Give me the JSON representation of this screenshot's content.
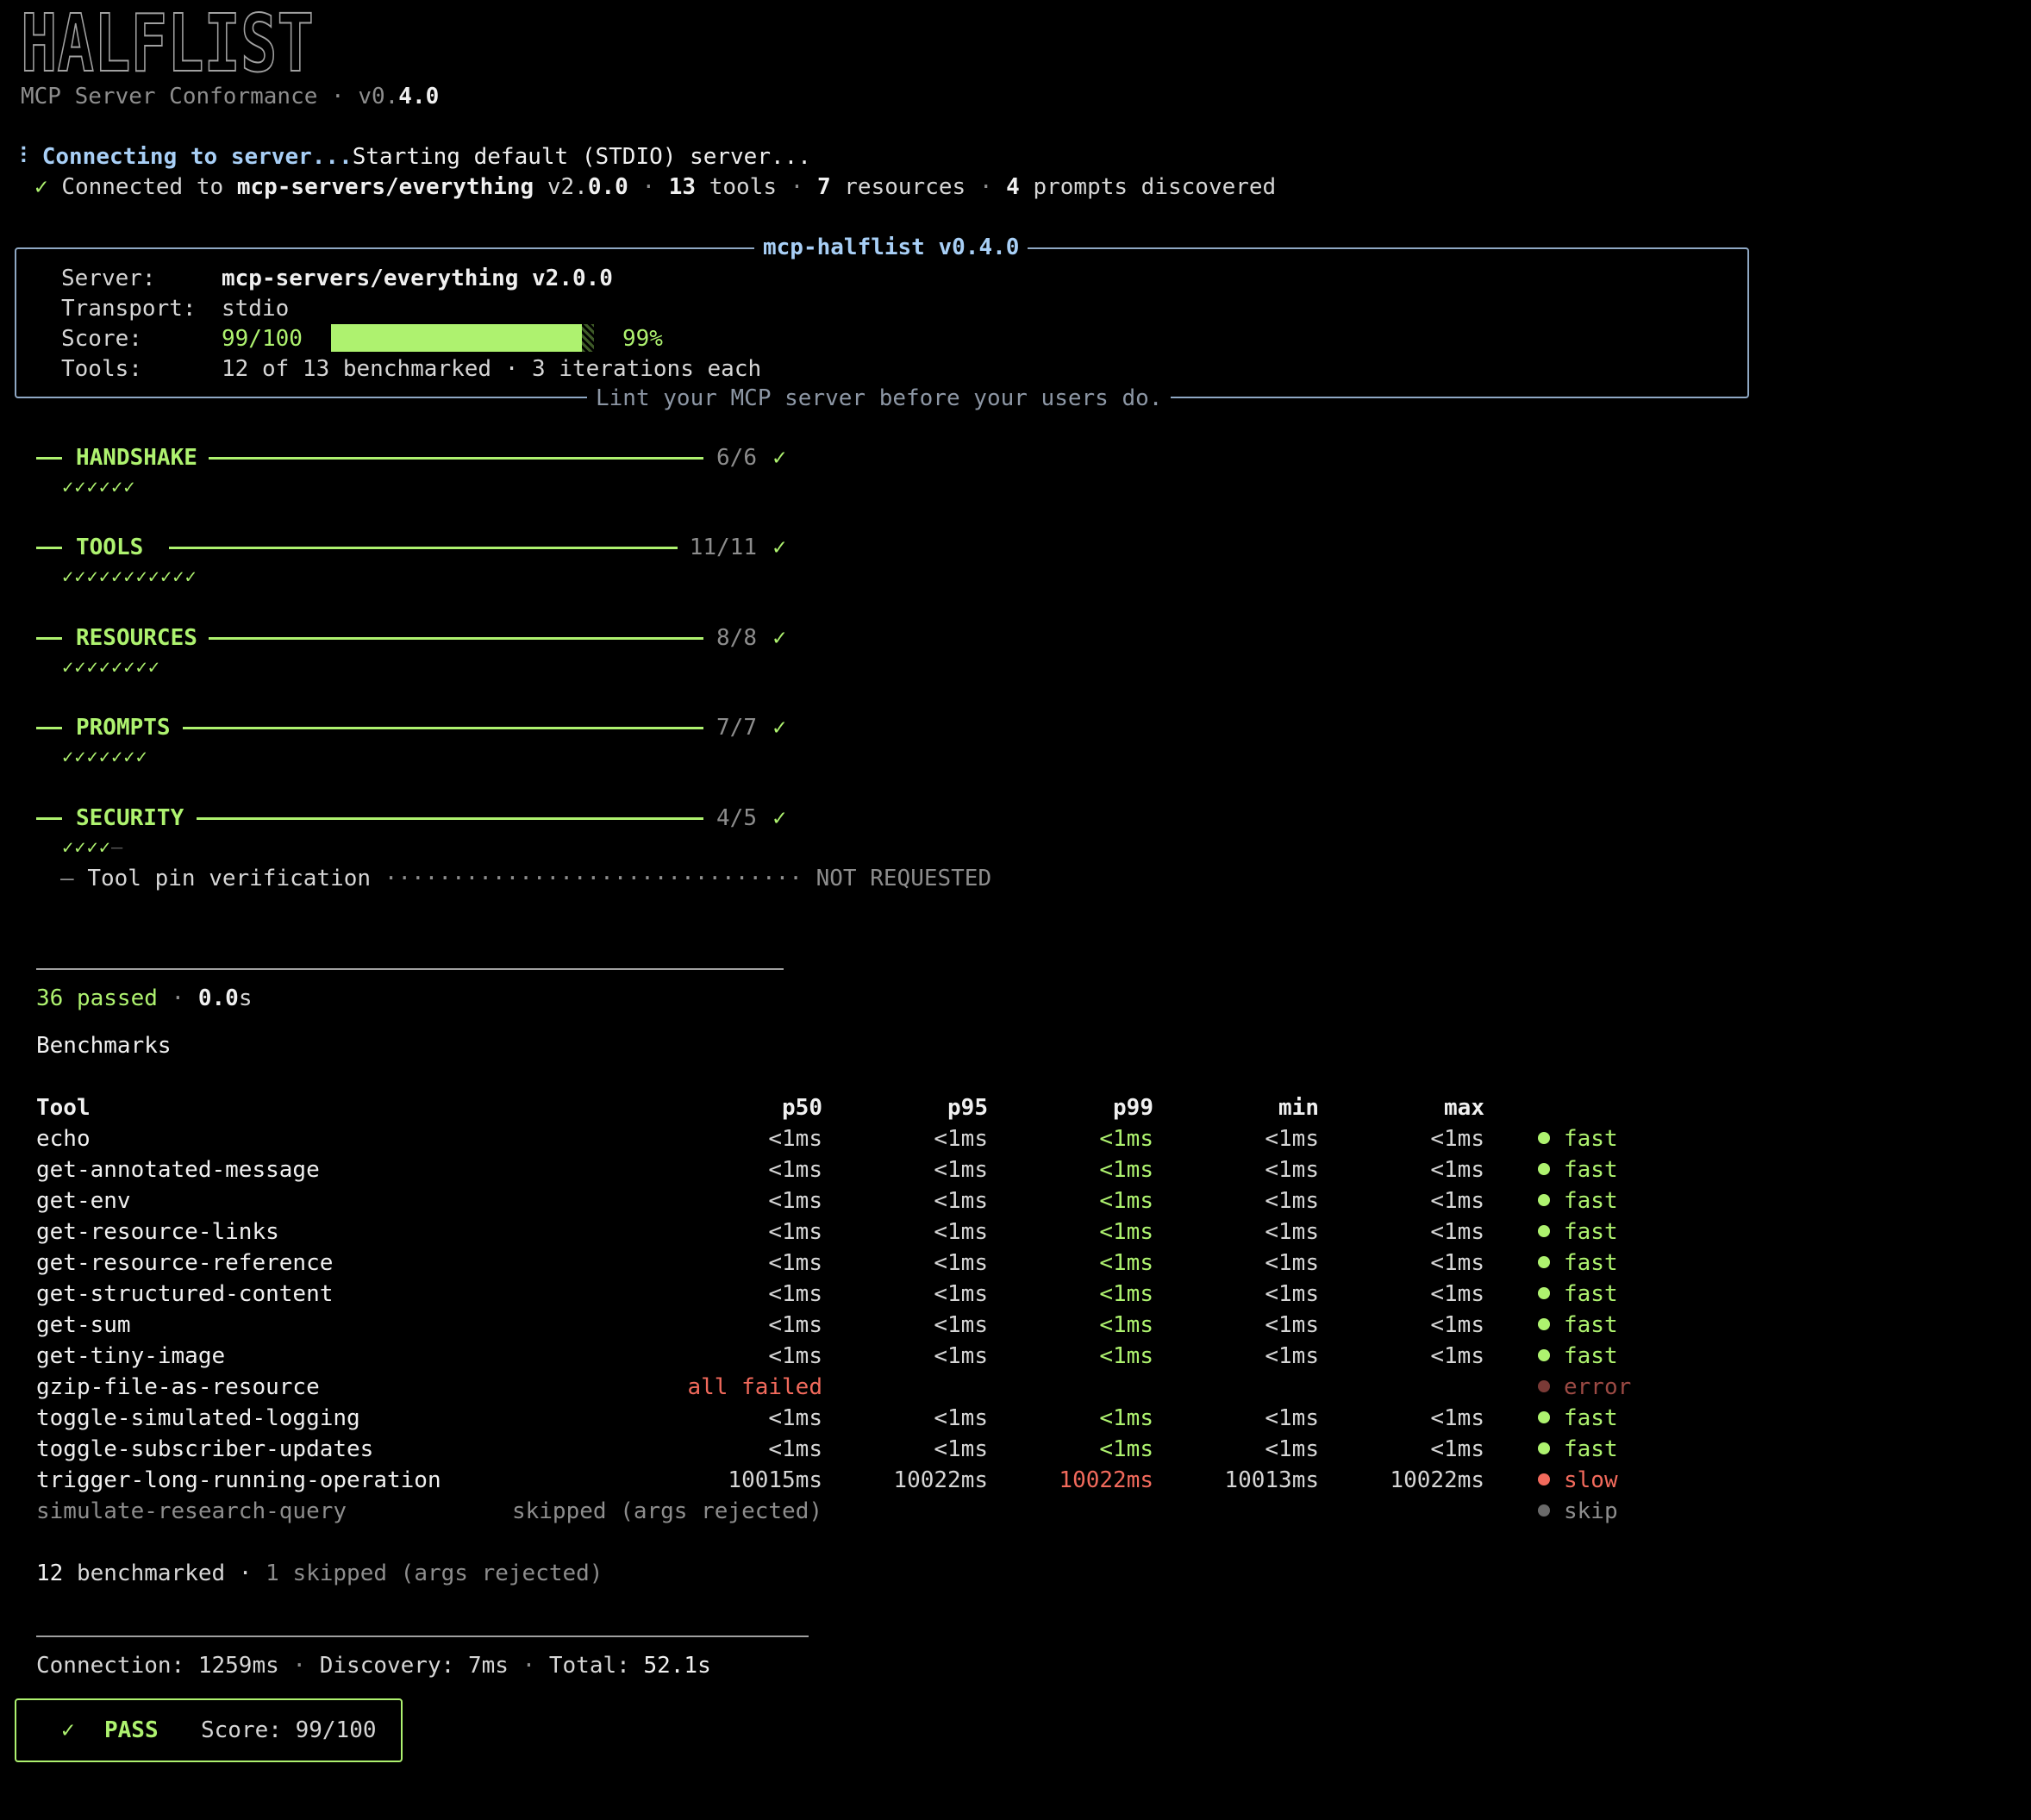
{
  "header": {
    "logo": "HALFLIST",
    "subtitle_prefix": "MCP Server Conformance · v0.",
    "subtitle_version_bold": "4.0"
  },
  "connection": {
    "spinner": "⠸",
    "connecting_label": "Connecting to server...",
    "starting_label": "Starting default (STDIO) server...",
    "connected_check": "✓",
    "connected_prefix": "Connected to",
    "server_name": "mcp-servers/everything",
    "server_version_prefix": "v2.",
    "server_version_bold": "0.0",
    "tools_count": "13",
    "tools_label": "tools",
    "resources_count": "7",
    "resources_label": "resources",
    "prompts_count": "4",
    "prompts_label": "prompts discovered"
  },
  "summary": {
    "title": "mcp-halflist v0.4.0",
    "footer": "Lint your MCP server before your users do.",
    "server_label": "Server:",
    "server_value": "mcp-servers/everything v2.0.0",
    "transport_label": "Transport:",
    "transport_value": "stdio",
    "score_label": "Score:",
    "score_value": "99/100",
    "score_percent": "99%",
    "score_fraction": 0.99,
    "tools_label": "Tools:",
    "tools_value": "12 of 13 benchmarked · 3 iterations each"
  },
  "sections": [
    {
      "title": "HANDSHAKE",
      "count": "6/6",
      "tick": "✓",
      "checks": "✓✓✓✓✓✓",
      "pending": ""
    },
    {
      "title": "TOOLS",
      "count": "11/11",
      "tick": "✓",
      "checks": "✓✓✓✓✓✓✓✓✓✓✓",
      "pending": ""
    },
    {
      "title": "RESOURCES",
      "count": "8/8",
      "tick": "✓",
      "checks": "✓✓✓✓✓✓✓✓",
      "pending": ""
    },
    {
      "title": "PROMPTS",
      "count": "7/7",
      "tick": "✓",
      "checks": "✓✓✓✓✓✓✓",
      "pending": ""
    },
    {
      "title": "SECURITY",
      "count": "4/5",
      "tick": "✓",
      "checks": "✓✓✓✓",
      "pending": "–"
    }
  ],
  "security_note": {
    "dash": "–",
    "label": "Tool pin verification",
    "leader": "·······························",
    "status": "NOT REQUESTED"
  },
  "results": {
    "passed_count": "36",
    "passed_label": "passed",
    "duration_bold": "0.0",
    "duration_unit": "s"
  },
  "benchmarks": {
    "heading": "Benchmarks",
    "columns": [
      "Tool",
      "p50",
      "p95",
      "p99",
      "min",
      "max"
    ],
    "rows": [
      {
        "tool": "echo",
        "p50": "<1ms",
        "p95": "<1ms",
        "p99": "<1ms",
        "min": "<1ms",
        "max": "<1ms",
        "status": "fast",
        "kind": "fast"
      },
      {
        "tool": "get-annotated-message",
        "p50": "<1ms",
        "p95": "<1ms",
        "p99": "<1ms",
        "min": "<1ms",
        "max": "<1ms",
        "status": "fast",
        "kind": "fast"
      },
      {
        "tool": "get-env",
        "p50": "<1ms",
        "p95": "<1ms",
        "p99": "<1ms",
        "min": "<1ms",
        "max": "<1ms",
        "status": "fast",
        "kind": "fast"
      },
      {
        "tool": "get-resource-links",
        "p50": "<1ms",
        "p95": "<1ms",
        "p99": "<1ms",
        "min": "<1ms",
        "max": "<1ms",
        "status": "fast",
        "kind": "fast"
      },
      {
        "tool": "get-resource-reference",
        "p50": "<1ms",
        "p95": "<1ms",
        "p99": "<1ms",
        "min": "<1ms",
        "max": "<1ms",
        "status": "fast",
        "kind": "fast"
      },
      {
        "tool": "get-structured-content",
        "p50": "<1ms",
        "p95": "<1ms",
        "p99": "<1ms",
        "min": "<1ms",
        "max": "<1ms",
        "status": "fast",
        "kind": "fast"
      },
      {
        "tool": "get-sum",
        "p50": "<1ms",
        "p95": "<1ms",
        "p99": "<1ms",
        "min": "<1ms",
        "max": "<1ms",
        "status": "fast",
        "kind": "fast"
      },
      {
        "tool": "get-tiny-image",
        "p50": "<1ms",
        "p95": "<1ms",
        "p99": "<1ms",
        "min": "<1ms",
        "max": "<1ms",
        "status": "fast",
        "kind": "fast"
      },
      {
        "tool": "gzip-file-as-resource",
        "p50": "all failed",
        "p95": "",
        "p99": "",
        "min": "",
        "max": "",
        "status": "error",
        "kind": "error"
      },
      {
        "tool": "toggle-simulated-logging",
        "p50": "<1ms",
        "p95": "<1ms",
        "p99": "<1ms",
        "min": "<1ms",
        "max": "<1ms",
        "status": "fast",
        "kind": "fast"
      },
      {
        "tool": "toggle-subscriber-updates",
        "p50": "<1ms",
        "p95": "<1ms",
        "p99": "<1ms",
        "min": "<1ms",
        "max": "<1ms",
        "status": "fast",
        "kind": "fast"
      },
      {
        "tool": "trigger-long-running-operation",
        "p50": "10015ms",
        "p95": "10022ms",
        "p99": "10022ms",
        "min": "10013ms",
        "max": "10022ms",
        "status": "slow",
        "kind": "slow"
      },
      {
        "tool": "simulate-research-query",
        "p50": "skipped (args rejected)",
        "p95": "",
        "p99": "",
        "min": "",
        "max": "",
        "status": "skip",
        "kind": "skip"
      }
    ],
    "summary_count": "12",
    "summary_label": "benchmarked ·",
    "skipped_count": "1",
    "skipped_label": "skipped (args rejected)"
  },
  "timing": {
    "connection_label": "Connection:",
    "connection_value": "1259ms",
    "discovery_label": "Discovery:",
    "discovery_value": "7ms",
    "total_label": "Total:",
    "total_value": "52.1s",
    "separator": "·"
  },
  "verdict": {
    "check": "✓",
    "label": "PASS",
    "score_label": "Score:",
    "score_value": "99/100"
  },
  "colors": {
    "background": "#000000",
    "accent_green": "#aef26f",
    "error_red": "#f26a5c",
    "box_border": "#8fa8c4",
    "title_blue": "#a8cff6"
  }
}
